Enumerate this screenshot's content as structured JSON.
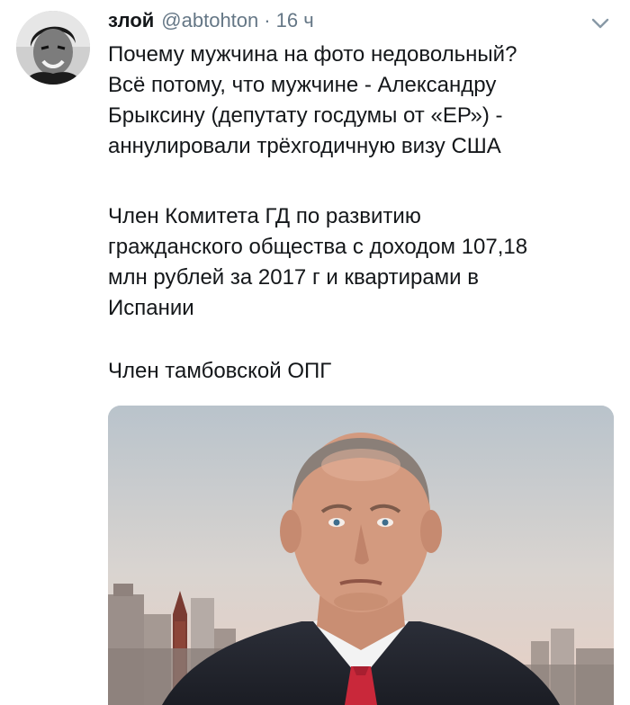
{
  "tweet": {
    "display_name": "злой",
    "handle": "@abtohton",
    "separator": "·",
    "time": "16 ч",
    "paragraph1": [
      "Почему мужчина на фото недовольный?",
      "Всё потому, что мужчине - Александру",
      "Брыксину (депутату госдумы от «ЕР») -",
      "аннулировали трёхгодичную визу США"
    ],
    "paragraph2": [
      "Член Комитета ГД по развитию",
      "гражданского общества с доходом 107,18",
      "млн рублей за 2017 г и квартирами в",
      "Испании"
    ],
    "paragraph3": [
      "Член тамбовской ОПГ"
    ]
  },
  "icons": {
    "caret": "chevron-down-icon"
  },
  "colors": {
    "text": "#14171a",
    "secondary": "#657786"
  }
}
